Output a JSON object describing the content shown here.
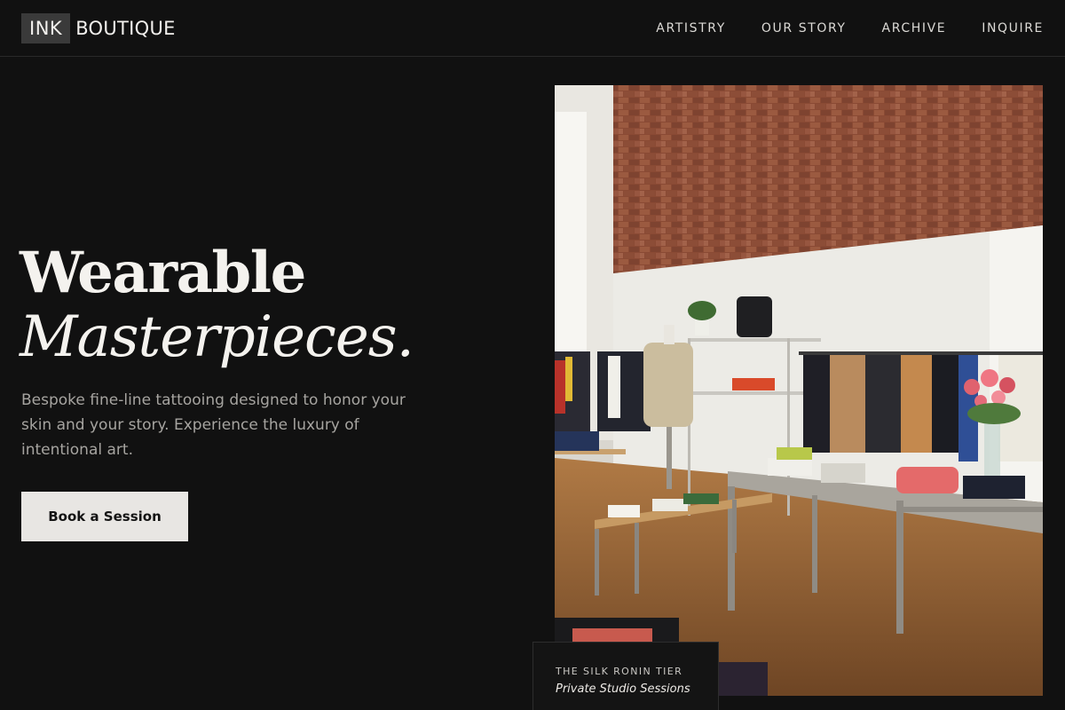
{
  "header": {
    "logo_box": "INK",
    "logo_word": "BOUTIQUE",
    "nav": [
      "ARTISTRY",
      "OUR STORY",
      "ARCHIVE",
      "INQUIRE"
    ]
  },
  "hero": {
    "title_line1": "Wearable",
    "title_line2": "Masterpieces.",
    "copy": "Bespoke fine-line tattooing designed to honor your skin and your story. Experience the luxury of intentional art.",
    "cta_label": "Book a Session"
  },
  "feature": {
    "image_alt": "Boutique interior with brick wall, clothing racks and wooden tables",
    "tier": "THE SILK RONIN TIER",
    "sessions": "Private Studio Sessions"
  },
  "colors": {
    "background": "#111111",
    "cta_background": "#e8e6e3",
    "muted_text": "#a6a4a0"
  }
}
